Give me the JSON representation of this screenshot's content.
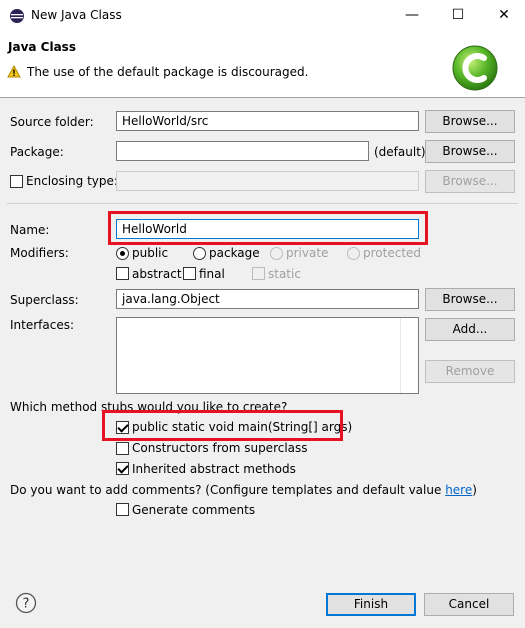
{
  "window": {
    "title": "New Java Class",
    "minimize": "—",
    "maximize": "☐",
    "close": "✕"
  },
  "header": {
    "title": "Java Class",
    "message": "The use of the default package is discouraged."
  },
  "form": {
    "source_folder_label": "Source folder:",
    "source_folder_value": "HelloWorld/src",
    "package_label": "Package:",
    "package_value": "",
    "package_default": "(default)",
    "enclosing_type_label": "Enclosing type:",
    "browse_label": "Browse...",
    "name_label": "Name:",
    "name_value": "HelloWorld",
    "modifiers_label": "Modifiers:",
    "mod_public": "public",
    "mod_package": "package",
    "mod_private": "private",
    "mod_protected": "protected",
    "mod_abstract": "abstract",
    "mod_final": "final",
    "mod_static": "static",
    "superclass_label": "Superclass:",
    "superclass_value": "java.lang.Object",
    "interfaces_label": "Interfaces:",
    "add_label": "Add...",
    "remove_label": "Remove",
    "stubs_question": "Which method stubs would you like to create?",
    "stub_main": "public static void main(String[] args)",
    "stub_constructors": "Constructors from superclass",
    "stub_inherited": "Inherited abstract methods",
    "comments_question": "Do you want to add comments? (Configure templates and default value ",
    "comments_link": "here",
    "comments_close": ")",
    "generate_comments": "Generate comments"
  },
  "footer": {
    "finish_label": "Finish",
    "cancel_label": "Cancel",
    "help_icon_text": "?"
  }
}
